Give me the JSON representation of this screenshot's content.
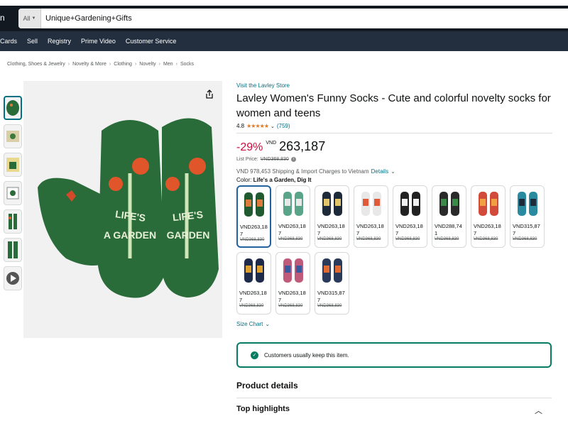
{
  "search": {
    "category": "All",
    "query": "Unique+Gardening+Gifts"
  },
  "nav": {
    "items": [
      "Cards",
      "Sell",
      "Registry",
      "Prime Video",
      "Customer Service"
    ]
  },
  "breadcrumbs": [
    "Clothing, Shoes & Jewelry",
    "Novelty & More",
    "Clothing",
    "Novelty",
    "Men",
    "Socks"
  ],
  "product": {
    "store_link": "Visit the Lavley Store",
    "title": "Lavley Women's Funny Socks - Cute and colorful novelty socks for women and teens",
    "rating": "4.8",
    "stars": "★★★★★",
    "review_count": "(759)",
    "discount": "-29%",
    "currency": "VND",
    "price": "263,187",
    "list_price_label": "List Price:",
    "list_price": "VND368,830",
    "shipping": "VND 978,453 Shipping & Import Charges to Vietnam",
    "shipping_link": "Details",
    "color_label": "Color:",
    "color_value": "Life's a Garden, Dig It",
    "size_chart": "Size Chart",
    "keep_message": "Customers usually keep this item.",
    "product_details": "Product details",
    "top_highlights": "Top highlights"
  },
  "swatches": [
    {
      "price": "VND263,187",
      "old": "VND368,830",
      "c1": "#1f5a30",
      "c2": "#e07a3a"
    },
    {
      "price": "VND263,187",
      "old": "VND368,830",
      "c1": "#5aa58a",
      "c2": "#e8e8e8"
    },
    {
      "price": "VND263,187",
      "old": "VND368,830",
      "c1": "#1d2a3a",
      "c2": "#e2c46a"
    },
    {
      "price": "VND263,187",
      "old": "VND368,830",
      "c1": "#e8e8e8",
      "c2": "#e05a3a"
    },
    {
      "price": "VND263,187",
      "old": "VND368,830",
      "c1": "#222222",
      "c2": "#f0f0f0"
    },
    {
      "price": "VND288,741",
      "old": "VND368,830",
      "c1": "#2a2a2a",
      "c2": "#3a8a4a"
    },
    {
      "price": "VND263,187",
      "old": "VND368,830",
      "c1": "#d24a3a",
      "c2": "#f0a040"
    },
    {
      "price": "VND315,877",
      "old": "VND368,830",
      "c1": "#2a8aa0",
      "c2": "#1d2a3a"
    },
    {
      "price": "VND263,187",
      "old": "VND368,830",
      "c1": "#1d2a4a",
      "c2": "#e0a030"
    },
    {
      "price": "VND263,187",
      "old": "VND368,830",
      "c1": "#c05a7a",
      "c2": "#3a5aa0"
    },
    {
      "price": "VND315,877",
      "old": "VND368,830",
      "c1": "#2a3a5a",
      "c2": "#e06a30"
    }
  ],
  "colors": {
    "nav_dark": "#131921",
    "nav_sub": "#232f3e",
    "link": "#007185",
    "discount": "#cc0c39",
    "star": "#de7921",
    "sock_green": "#2a6b3a",
    "keep_green": "#067d62"
  }
}
